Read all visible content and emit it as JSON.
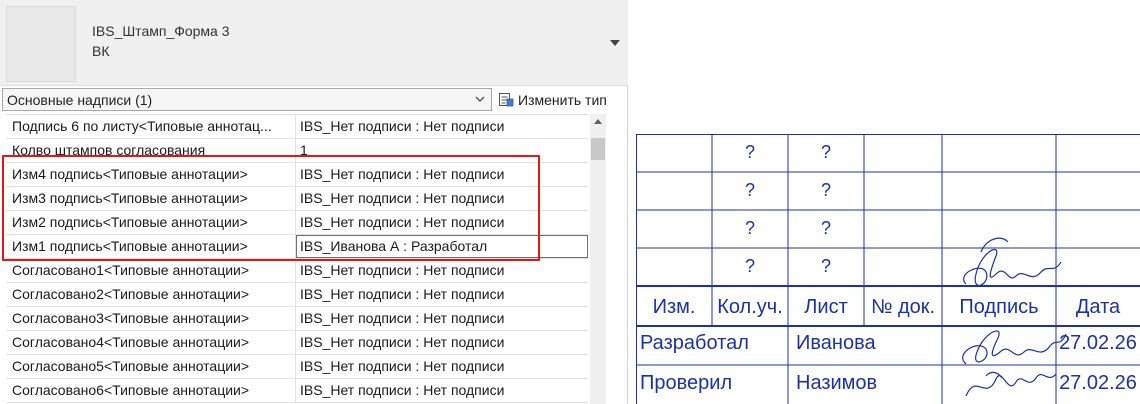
{
  "type_selector": {
    "family_name": "IBS_Штамп_Форма 3",
    "type_name": "ВК"
  },
  "filter": {
    "category_label": "Основные надписи (1)",
    "edit_type_label": "Изменить тип"
  },
  "properties": [
    {
      "name": "Подпись 6 по листу<Типовые аннотац...",
      "value": "IBS_Нет подписи : Нет подписи"
    },
    {
      "name": "Колво штампов согласования",
      "value": "1"
    },
    {
      "name": "Изм4 подпись<Типовые аннотации>",
      "value": "IBS_Нет подписи : Нет подписи"
    },
    {
      "name": "Изм3 подпись<Типовые аннотации>",
      "value": "IBS_Нет подписи : Нет подписи"
    },
    {
      "name": "Изм2 подпись<Типовые аннотации>",
      "value": "IBS_Нет подписи : Нет подписи"
    },
    {
      "name": "Изм1 подпись<Типовые аннотации>",
      "value": "IBS_Иванова А : Разработал"
    },
    {
      "name": "Согласовано1<Типовые аннотации>",
      "value": "IBS_Нет подписи : Нет подписи"
    },
    {
      "name": "Согласовано2<Типовые аннотации>",
      "value": "IBS_Нет подписи : Нет подписи"
    },
    {
      "name": "Согласовано3<Типовые аннотации>",
      "value": "IBS_Нет подписи : Нет подписи"
    },
    {
      "name": "Согласовано4<Типовые аннотации>",
      "value": "IBS_Нет подписи : Нет подписи"
    },
    {
      "name": "Согласовано5<Типовые аннотации>",
      "value": "IBS_Нет подписи : Нет подписи"
    },
    {
      "name": "Согласовано6<Типовые аннотации>",
      "value": "IBS_Нет подписи : Нет подписи"
    }
  ],
  "stamp": {
    "placeholder": "?",
    "headers": [
      "Изм.",
      "Кол.уч.",
      "Лист",
      "№ док.",
      "Подпись",
      "Дата"
    ],
    "rows": [
      {
        "role": "Разработал",
        "name": "Иванова",
        "date": "27.02.26"
      },
      {
        "role": "Проверил",
        "name": "Назимов",
        "date": "27.02.26"
      }
    ],
    "ink_color": "#1a33a8"
  },
  "colors": {
    "highlight": "#e01818"
  }
}
